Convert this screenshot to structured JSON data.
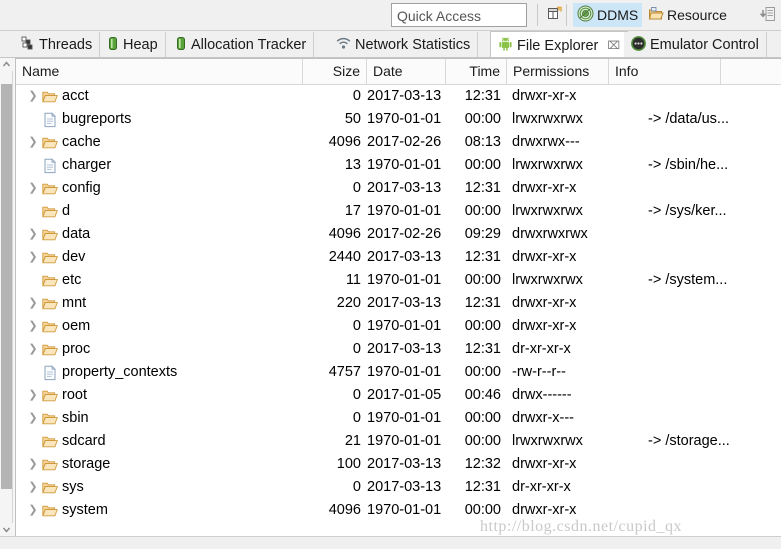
{
  "toolbar": {
    "quick_access_placeholder": "Quick Access",
    "new_perspective_icon": "new-perspective-icon",
    "perspectives": [
      {
        "label": "DDMS",
        "icon": "ddms-icon",
        "active": true
      },
      {
        "label": "Resource",
        "icon": "resource-icon",
        "active": false
      }
    ],
    "restore_icon": "restore-perspective-icon"
  },
  "tabs": [
    {
      "label": "Threads",
      "icon": "threads-icon",
      "selected": false,
      "closable": false
    },
    {
      "label": "Heap",
      "icon": "heap-icon",
      "selected": false,
      "closable": false
    },
    {
      "label": "Allocation Tracker",
      "icon": "allocation-tracker-icon",
      "selected": false,
      "closable": false
    },
    {
      "label": "Network Statistics",
      "icon": "network-statistics-icon",
      "selected": false,
      "closable": false
    },
    {
      "label": "File Explorer",
      "icon": "android-icon",
      "selected": true,
      "closable": true,
      "close_glyph": "⌧"
    },
    {
      "label": "Emulator Control",
      "icon": "emulator-control-icon",
      "selected": false,
      "closable": false
    }
  ],
  "table": {
    "columns": [
      {
        "key": "name",
        "label": "Name",
        "align": "left"
      },
      {
        "key": "size",
        "label": "Size",
        "align": "right"
      },
      {
        "key": "date",
        "label": "Date",
        "align": "left"
      },
      {
        "key": "time",
        "label": "Time",
        "align": "right"
      },
      {
        "key": "permissions",
        "label": "Permissions",
        "align": "left"
      },
      {
        "key": "info",
        "label": "Info",
        "align": "left"
      }
    ],
    "rows": [
      {
        "name": "acct",
        "type": "folder",
        "expandable": true,
        "size": "0",
        "date": "2017-03-13",
        "time": "12:31",
        "permissions": "drwxr-xr-x",
        "info": ""
      },
      {
        "name": "bugreports",
        "type": "file",
        "expandable": false,
        "size": "50",
        "date": "1970-01-01",
        "time": "00:00",
        "permissions": "lrwxrwxrwx",
        "info": "-> /data/us..."
      },
      {
        "name": "cache",
        "type": "folder",
        "expandable": true,
        "size": "4096",
        "date": "2017-02-26",
        "time": "08:13",
        "permissions": "drwxrwx---",
        "info": ""
      },
      {
        "name": "charger",
        "type": "file",
        "expandable": false,
        "size": "13",
        "date": "1970-01-01",
        "time": "00:00",
        "permissions": "lrwxrwxrwx",
        "info": "-> /sbin/he..."
      },
      {
        "name": "config",
        "type": "folder",
        "expandable": true,
        "size": "0",
        "date": "2017-03-13",
        "time": "12:31",
        "permissions": "drwxr-xr-x",
        "info": ""
      },
      {
        "name": "d",
        "type": "folder",
        "expandable": false,
        "size": "17",
        "date": "1970-01-01",
        "time": "00:00",
        "permissions": "lrwxrwxrwx",
        "info": "-> /sys/ker..."
      },
      {
        "name": "data",
        "type": "folder",
        "expandable": true,
        "size": "4096",
        "date": "2017-02-26",
        "time": "09:29",
        "permissions": "drwxrwxrwx",
        "info": ""
      },
      {
        "name": "dev",
        "type": "folder",
        "expandable": true,
        "size": "2440",
        "date": "2017-03-13",
        "time": "12:31",
        "permissions": "drwxr-xr-x",
        "info": ""
      },
      {
        "name": "etc",
        "type": "folder",
        "expandable": false,
        "size": "11",
        "date": "1970-01-01",
        "time": "00:00",
        "permissions": "lrwxrwxrwx",
        "info": "-> /system..."
      },
      {
        "name": "mnt",
        "type": "folder",
        "expandable": true,
        "size": "220",
        "date": "2017-03-13",
        "time": "12:31",
        "permissions": "drwxr-xr-x",
        "info": ""
      },
      {
        "name": "oem",
        "type": "folder",
        "expandable": true,
        "size": "0",
        "date": "1970-01-01",
        "time": "00:00",
        "permissions": "drwxr-xr-x",
        "info": ""
      },
      {
        "name": "proc",
        "type": "folder",
        "expandable": true,
        "size": "0",
        "date": "2017-03-13",
        "time": "12:31",
        "permissions": "dr-xr-xr-x",
        "info": ""
      },
      {
        "name": "property_contexts",
        "type": "file",
        "expandable": false,
        "size": "4757",
        "date": "1970-01-01",
        "time": "00:00",
        "permissions": "-rw-r--r--",
        "info": ""
      },
      {
        "name": "root",
        "type": "folder",
        "expandable": true,
        "size": "0",
        "date": "2017-01-05",
        "time": "00:46",
        "permissions": "drwx------",
        "info": ""
      },
      {
        "name": "sbin",
        "type": "folder",
        "expandable": true,
        "size": "0",
        "date": "1970-01-01",
        "time": "00:00",
        "permissions": "drwxr-x---",
        "info": ""
      },
      {
        "name": "sdcard",
        "type": "folder",
        "expandable": false,
        "size": "21",
        "date": "1970-01-01",
        "time": "00:00",
        "permissions": "lrwxrwxrwx",
        "info": "-> /storage..."
      },
      {
        "name": "storage",
        "type": "folder",
        "expandable": true,
        "size": "100",
        "date": "2017-03-13",
        "time": "12:32",
        "permissions": "drwxr-xr-x",
        "info": ""
      },
      {
        "name": "sys",
        "type": "folder",
        "expandable": true,
        "size": "0",
        "date": "2017-03-13",
        "time": "12:31",
        "permissions": "dr-xr-xr-x",
        "info": ""
      },
      {
        "name": "system",
        "type": "folder",
        "expandable": true,
        "size": "4096",
        "date": "1970-01-01",
        "time": "00:00",
        "permissions": "drwxr-xr-x",
        "info": ""
      }
    ]
  },
  "watermark": {
    "text": "http://blog.csdn.net/cupid_qx"
  },
  "colors": {
    "accent_selection": "#cde6f7",
    "folder": "#e8b974",
    "android_green": "#8bc34a",
    "panel_bg": "#ffffff",
    "chrome_bg": "#f0f0f0",
    "scrollbar_thumb": "#b4b4b4"
  }
}
